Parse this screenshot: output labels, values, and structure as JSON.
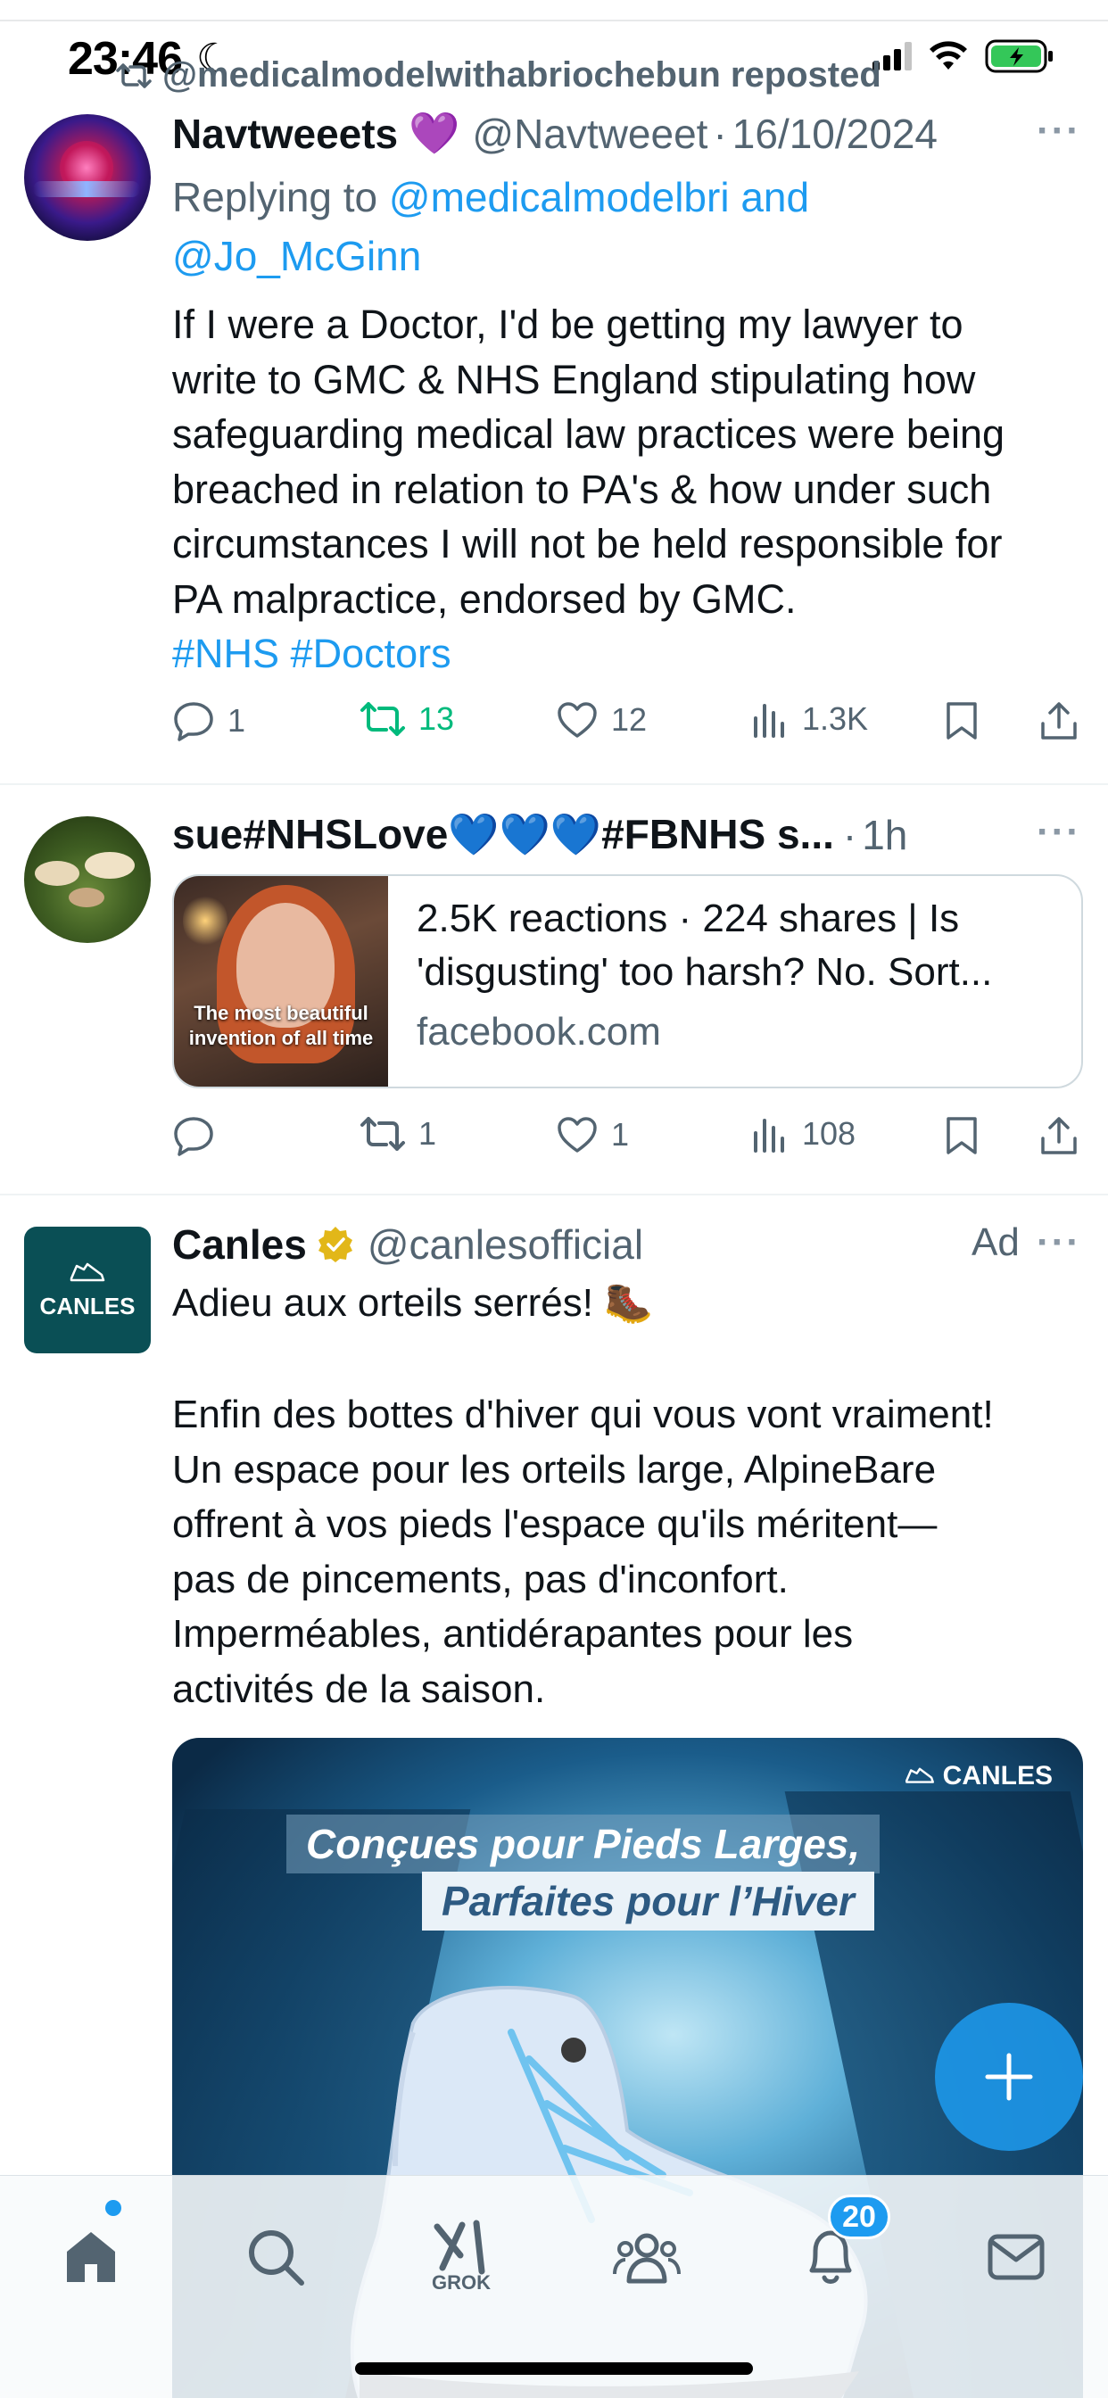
{
  "status_bar": {
    "time": "23:46"
  },
  "repost_banner": {
    "text": "@medicalmodelwithabriochebun reposted"
  },
  "post1": {
    "name": "Navtweeets",
    "name_emoji": "💜",
    "handle": "@Navtweeet",
    "separator": "·",
    "date": "16/10/2024",
    "replying_prefix": "Replying to ",
    "replying_to": "@medicalmodelbri and",
    "replying_to_2": "@Jo_McGinn",
    "text_lines": [
      "If I were a Doctor, I'd be getting my lawyer to",
      "write to GMC & NHS England stipulating how",
      "safeguarding medical law practices were being",
      "breached in relation to PA's & how under such",
      "circumstances I will not be held responsible for",
      "PA malpractice, endorsed by GMC."
    ],
    "hashtags": "#NHS #Doctors",
    "replies": "1",
    "reposts": "13",
    "likes": "12",
    "views": "1.3K"
  },
  "post2": {
    "name": "sue#NHSLove💙💙💙#FBNHS s...",
    "separator": "·",
    "time": "1h",
    "card": {
      "thumb_caption": "The most beautiful invention of all time",
      "line1": "2.5K reactions · 224 shares | Is",
      "line2": "'disgusting' too harsh? No. Sort...",
      "domain": "facebook.com"
    },
    "replies": "",
    "reposts": "1",
    "likes": "1",
    "views": "108"
  },
  "post3": {
    "name": "Canles",
    "handle": "@canlesofficial",
    "ad_label": "Ad",
    "avatar_text": "CANLES",
    "line1": "Adieu aux orteils serrés! 🥾",
    "text_lines": [
      "Enfin des bottes d'hiver qui vous vont vraiment!",
      "Un espace pour les orteils large, AlpineBare",
      "offrent à vos pieds l'espace qu'ils méritent—",
      "pas de pincements, pas d'inconfort.",
      "Imperméables, antidérapantes pour les",
      "activités de la saison."
    ],
    "image": {
      "brand": "CANLES",
      "banner1": "Conçues pour Pieds Larges,",
      "banner2": "Parfaites pour l’Hiver"
    }
  },
  "tabbar": {
    "grok_label": "GROK",
    "notifications_badge": "20"
  },
  "colors": {
    "accent": "#1d9bf0",
    "repost_green": "#00ba7c",
    "muted": "#536471",
    "canles_teal": "#0a4f55"
  },
  "icons": [
    "retweet-icon",
    "ellipsis-icon",
    "reply-icon",
    "repost-icon",
    "like-icon",
    "views-icon",
    "bookmark-icon",
    "share-icon",
    "verified-badge-icon",
    "plus-icon",
    "home-icon",
    "search-icon",
    "grok-icon",
    "communities-icon",
    "notifications-icon",
    "messages-icon"
  ]
}
